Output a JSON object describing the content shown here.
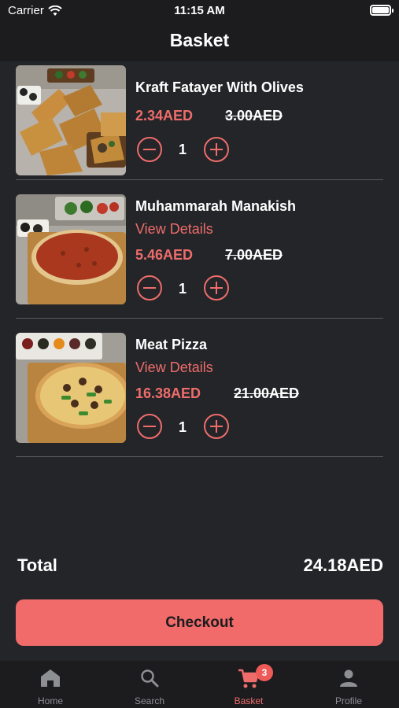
{
  "status_bar": {
    "carrier": "Carrier",
    "time": "11:15 AM"
  },
  "header": {
    "title": "Basket"
  },
  "items": [
    {
      "name": "Kraft Fatayer With Olives",
      "details": "",
      "price": "2.34AED",
      "old_price": "3.00AED",
      "quantity": "1",
      "image_icon": "fatayer-food-image"
    },
    {
      "name": "Muhammarah Manakish",
      "details": "View Details",
      "price": "5.46AED",
      "old_price": "7.00AED",
      "quantity": "1",
      "image_icon": "manakish-food-image"
    },
    {
      "name": "Meat Pizza",
      "details": "View Details",
      "price": "16.38AED",
      "old_price": "21.00AED",
      "quantity": "1",
      "image_icon": "pizza-food-image"
    }
  ],
  "total": {
    "label": "Total",
    "value": "24.18AED"
  },
  "checkout": {
    "label": "Checkout"
  },
  "tabs": [
    {
      "label": "Home",
      "icon": "home-icon",
      "active": false
    },
    {
      "label": "Search",
      "icon": "search-icon",
      "active": false
    },
    {
      "label": "Basket",
      "icon": "cart-icon",
      "active": true,
      "badge": "3"
    },
    {
      "label": "Profile",
      "icon": "profile-icon",
      "active": false
    }
  ],
  "colors": {
    "accent": "#ee6d6b",
    "background": "#242529",
    "bar": "#1c1c1f"
  }
}
